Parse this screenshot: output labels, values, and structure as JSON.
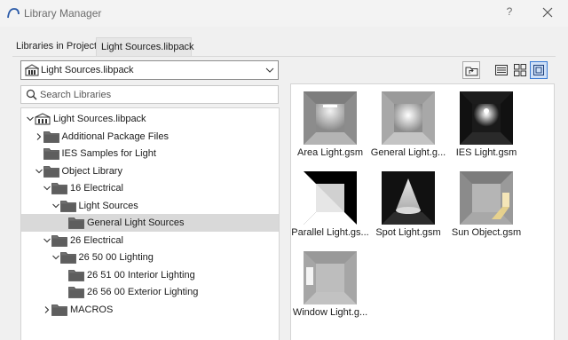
{
  "window": {
    "title": "Library Manager",
    "help_label": "?"
  },
  "tabs": {
    "inactive_label": "Libraries in Project",
    "active_label": "Light Sources.libpack"
  },
  "library_selector": {
    "selected": "Light Sources.libpack"
  },
  "search": {
    "placeholder": "Search Libraries",
    "value": ""
  },
  "tree": [
    {
      "label": "Light Sources.libpack",
      "level": 0,
      "expanded": true,
      "icon": "library-icon"
    },
    {
      "label": "Additional Package Files",
      "level": 1,
      "expanded": false,
      "icon": "folder-icon"
    },
    {
      "label": "IES Samples for Light",
      "level": 1,
      "expanded": null,
      "icon": "folder-icon"
    },
    {
      "label": "Object Library",
      "level": 1,
      "expanded": true,
      "icon": "folder-icon"
    },
    {
      "label": "16 Electrical",
      "level": 2,
      "expanded": true,
      "icon": "folder-icon"
    },
    {
      "label": "Light Sources",
      "level": 3,
      "expanded": true,
      "icon": "folder-icon"
    },
    {
      "label": "General Light Sources",
      "level": 4,
      "expanded": null,
      "icon": "folder-icon",
      "selected": true
    },
    {
      "label": "26 Electrical",
      "level": 2,
      "expanded": true,
      "icon": "folder-icon"
    },
    {
      "label": "26 50 00 Lighting",
      "level": 3,
      "expanded": true,
      "icon": "folder-icon"
    },
    {
      "label": "26 51 00 Interior Lighting",
      "level": 4,
      "expanded": null,
      "icon": "folder-icon"
    },
    {
      "label": "26 56 00 Exterior Lighting",
      "level": 4,
      "expanded": null,
      "icon": "folder-icon"
    },
    {
      "label": "MACROS",
      "level": 2,
      "expanded": false,
      "icon": "folder-icon"
    }
  ],
  "objects": [
    {
      "label": "Area Light.gsm",
      "icon": "area-light-thumbnail"
    },
    {
      "label": "General Light.g...",
      "icon": "general-light-thumbnail"
    },
    {
      "label": "IES Light.gsm",
      "icon": "ies-light-thumbnail"
    },
    {
      "label": "Parallel Light.gs...",
      "icon": "parallel-light-thumbnail"
    },
    {
      "label": "Spot Light.gsm",
      "icon": "spot-light-thumbnail"
    },
    {
      "label": "Sun Object.gsm",
      "icon": "sun-object-thumbnail"
    },
    {
      "label": "Window Light.g...",
      "icon": "window-light-thumbnail"
    }
  ],
  "colors": {
    "selection": "#d9d9d9",
    "active_view_button": "#cfe0f7",
    "accent": "#3a7bd5",
    "folder": "#6f6f6f"
  }
}
